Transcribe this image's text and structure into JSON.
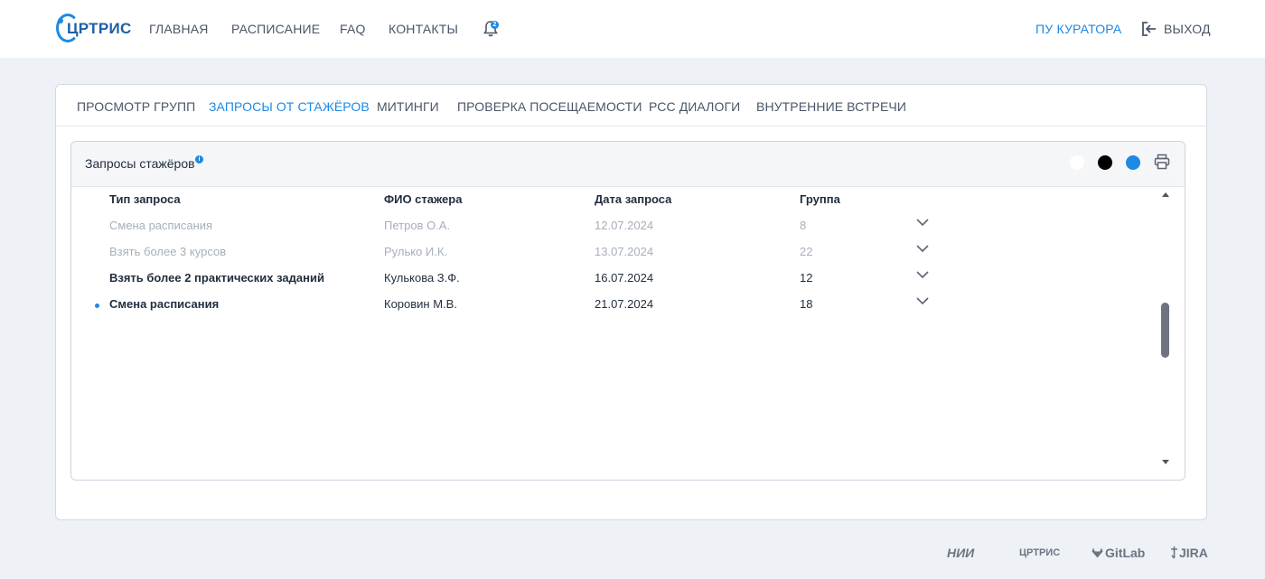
{
  "header": {
    "logo_text": "ЦРТРИС",
    "nav": [
      "ГЛАВНАЯ",
      "РАСПИСАНИЕ",
      "FAQ",
      "КОНТАКТЫ"
    ],
    "bell_badge": "2",
    "curator_link": "ПУ КУРАТОРА",
    "logout_label": "ВЫХОД"
  },
  "tabs": [
    {
      "label": "ПРОСМОТР ГРУПП",
      "active": false
    },
    {
      "label": "ЗАПРОСЫ ОТ СТАЖЁРОВ",
      "active": true
    },
    {
      "label": "МИТИНГИ",
      "active": false
    },
    {
      "label": "ПРОВЕРКА ПОСЕЩАЕМОСТИ",
      "active": false
    },
    {
      "label": "РСС ДИАЛОГИ",
      "active": false
    },
    {
      "label": "ВНУТРЕННИЕ ВСТРЕЧИ",
      "active": false
    }
  ],
  "card": {
    "title": "Запросы стажёров",
    "info_badge": "i",
    "swatches": [
      "#ffffff",
      "#000000",
      "#1e88e5"
    ]
  },
  "table": {
    "columns": [
      "Тип запроса",
      "ФИО стажера",
      "Дата запроса",
      "Группа"
    ],
    "rows": [
      {
        "type": "Смена расписания",
        "name": "Петров О.А.",
        "date": "12.07.2024",
        "group": "8",
        "state": "muted",
        "unread": false
      },
      {
        "type": "Взять более 3 курсов",
        "name": "Рулько И.К.",
        "date": "13.07.2024",
        "group": "22",
        "state": "muted",
        "unread": false
      },
      {
        "type": "Взять более 2 практических заданий",
        "name": "Кулькова З.Ф.",
        "date": "16.07.2024",
        "group": "12",
        "state": "bold",
        "unread": false
      },
      {
        "type": "Смена расписания",
        "name": "Коровин М.В.",
        "date": "21.07.2024",
        "group": "18",
        "state": "bold",
        "unread": true
      }
    ]
  },
  "footer": {
    "logos": [
      "НИИ",
      "ЦРТРИС",
      "GitLab",
      "JIRA"
    ]
  },
  "colors": {
    "accent": "#1e88e5",
    "muted_text": "#a7afba",
    "page_bg": "#eef1f6"
  }
}
